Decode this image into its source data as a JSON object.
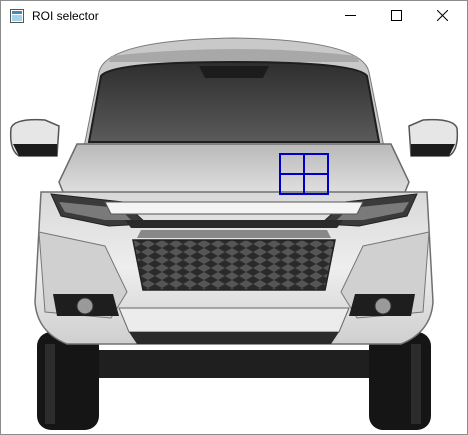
{
  "window": {
    "title": "ROI selector",
    "app_icon": "opencv-window-icon",
    "controls": {
      "minimize_icon": "minimize-icon",
      "maximize_icon": "maximize-icon",
      "close_icon": "close-icon"
    }
  },
  "image": {
    "subject": "car-front-image",
    "roi_selection": {
      "color": "#0000c8",
      "grid": "2x2"
    }
  }
}
